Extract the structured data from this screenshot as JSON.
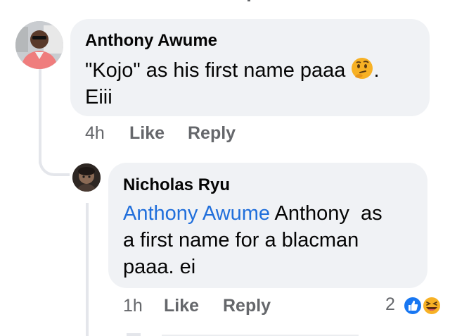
{
  "comments": [
    {
      "author": "Anthony Awume",
      "text_line1": "\"Kojo\" as his first name paaa",
      "emoji": "thinking-face",
      "text_line1_tail": ".",
      "text_line2": "Eiii",
      "time": "4h",
      "like_label": "Like",
      "reply_label": "Reply"
    }
  ],
  "reply": {
    "author": "Nicholas Ryu",
    "mention": "Anthony Awume",
    "text_line1_rest": " Anthony  as",
    "text_line2": "a first name for a blacman",
    "text_line3": "paaa. ei",
    "time": "1h",
    "like_label": "Like",
    "reply_label": "Reply",
    "reaction_count": "2",
    "reactions": [
      "like",
      "haha"
    ]
  },
  "colors": {
    "bubble": "#f0f2f5",
    "mention": "#216fdb",
    "secondary_text": "#65676b",
    "like_blue": "#1877f2",
    "haha_yellow": "#f7b125"
  }
}
